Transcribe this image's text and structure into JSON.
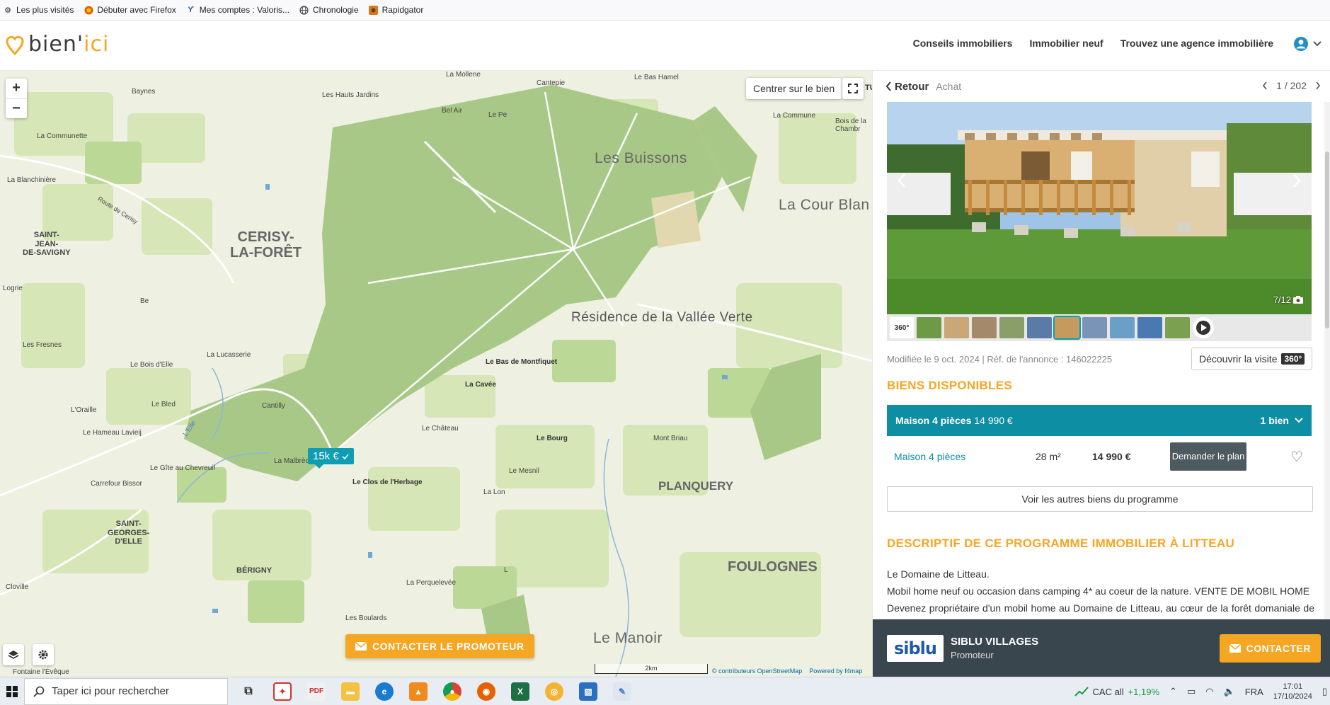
{
  "bookmarks": [
    {
      "label": "Les plus visités",
      "icon": "gear-icon"
    },
    {
      "label": "Débuter avec Firefox",
      "icon": "firefox-icon"
    },
    {
      "label": "Mes comptes : Valoris...",
      "icon": "bookmark-icon"
    },
    {
      "label": "Chronologie",
      "icon": "globe-icon"
    },
    {
      "label": "Rapidgator",
      "icon": "rapidgator-icon"
    }
  ],
  "header": {
    "logo": {
      "part1": "bien'",
      "part2": "ici"
    },
    "nav": [
      "Conseils immobiliers",
      "Immobilier neuf",
      "Trouvez une agence immobilière"
    ],
    "user_icon": "user-icon"
  },
  "map": {
    "center_label": "Centrer sur le bien",
    "fullscreen_suffix": "TU",
    "zoom_in": "+",
    "zoom_out": "−",
    "price_pin": "15k €",
    "contact_promoter": "CONTACTER LE PROMOTEUR",
    "scale": "2km",
    "attribution_1": "© contributeurs OpenStreetMap",
    "attribution_2": "Powered by f4map",
    "labels": {
      "la_mollene": "La Mollene",
      "le_bas_hamel": "Le Bas Hamel",
      "baynes": "Baynes",
      "cantepie": "Cantepie",
      "les_hauts_jardins": "Les Hauts Jardins",
      "bel_air": "Bel Air",
      "le_pe": "Le Pe",
      "la_commune_r": "La Commune",
      "les_buissons": "Les Buissons",
      "bois_chambre": "Bois de la Chambr",
      "la_communette": "La Communette",
      "la_blanchiniere": "La Blanchinière",
      "route_de_cerisy": "Route de Cerisy",
      "la_cour_blanche": "La Cour Blan",
      "saint_jean": "SAINT-\nJEAN-\nDE-SAVIGNY",
      "cerisy": "CERISY-\nLA-FORÊT",
      "logrie": "Logrie",
      "be": "Be",
      "residence": "Résidence de la Vallée Verte",
      "les_fresnes": "Les Fresnes",
      "la_lucasserie": "La Lucasserie",
      "le_bois_delle": "Le Bois d'Elle",
      "le_bas_montfiquet": "Le Bas de Montfiquet",
      "la_cavee": "La Cavée",
      "l_oraille": "L'Oraille",
      "le_bled": "Le Bled",
      "cantilly": "Cantilly",
      "le_hameau_lavieij": "Le Hameau Lavieij",
      "l_elle": "L'Elle",
      "le_chateau": "Le Château",
      "le_bourg": "Le Bourg",
      "mont_briau": "Mont Briau",
      "la_malbreche": "La Malbrèche",
      "le_gite": "Le Gîte au Chevreuil",
      "le_mesnil": "Le Mesnil",
      "planquery": "PLANQUERY",
      "carrefour_bissor": "Carrefour Bissor",
      "le_clos": "Le Clos de l'Herbage",
      "la_lo": "La Lon",
      "saint_georges": "SAINT-\nGEORGES-\nD'ELLE",
      "berigny": "BÉRIGNY",
      "foulognes": "FOULOGNES",
      "cloville": "Cloville",
      "la_perquelevee": "La Perquelevée",
      "les_boulards": "Les Boulards",
      "le_manoir": "Le Manoir",
      "fontaine": "Fontaine l'Évêque",
      "l_": "L"
    }
  },
  "panel": {
    "back_label": "Retour",
    "breadcrumb": "Achat",
    "pager": "1 / 202",
    "photo_counter": "7/12",
    "badge_360": "360°",
    "meta": "Modifiée le 9 oct. 2024 | Réf. de l'annonce : 146022225",
    "visit_label": "Découvrir la visite",
    "visit_tag": "360°",
    "biens_title": "BIENS DISPONIBLES",
    "bien_group": {
      "name": "Maison 4 pièces",
      "price": "14 990 €",
      "count": "1 bien"
    },
    "bien_row": {
      "type": "Maison 4 pièces",
      "surface": "28 m²",
      "price": "14 990 €",
      "plan_button": "Demander le plan"
    },
    "other_button": "Voir les autres biens du programme",
    "desc_title": "DESCRIPTIF DE CE PROGRAMME IMMOBILIER À LITTEAU",
    "desc_lines": [
      "Le Domaine de Litteau.",
      "Mobil home neuf ou occasion dans camping 4* au coeur de la nature. VENTE DE MOBIL HOME",
      "Devenez propriétaire d'un mobil home au Domaine de Litteau, au cœur de la forêt domaniale de Cerisy,"
    ],
    "promoter": {
      "logo": "siblu",
      "name": "SIBLU VILLAGES",
      "role": "Promoteur",
      "contact": "CONTACTER"
    }
  },
  "taskbar": {
    "search_placeholder": "Taper ici pour rechercher",
    "stock_label": "CAC all",
    "stock_change": "+1,19%",
    "lang": "FRA",
    "time": "17:01",
    "date": "17/10/2024"
  },
  "colors": {
    "accent": "#f5a623",
    "teal": "#0e8ea3",
    "dark": "#39464d"
  }
}
